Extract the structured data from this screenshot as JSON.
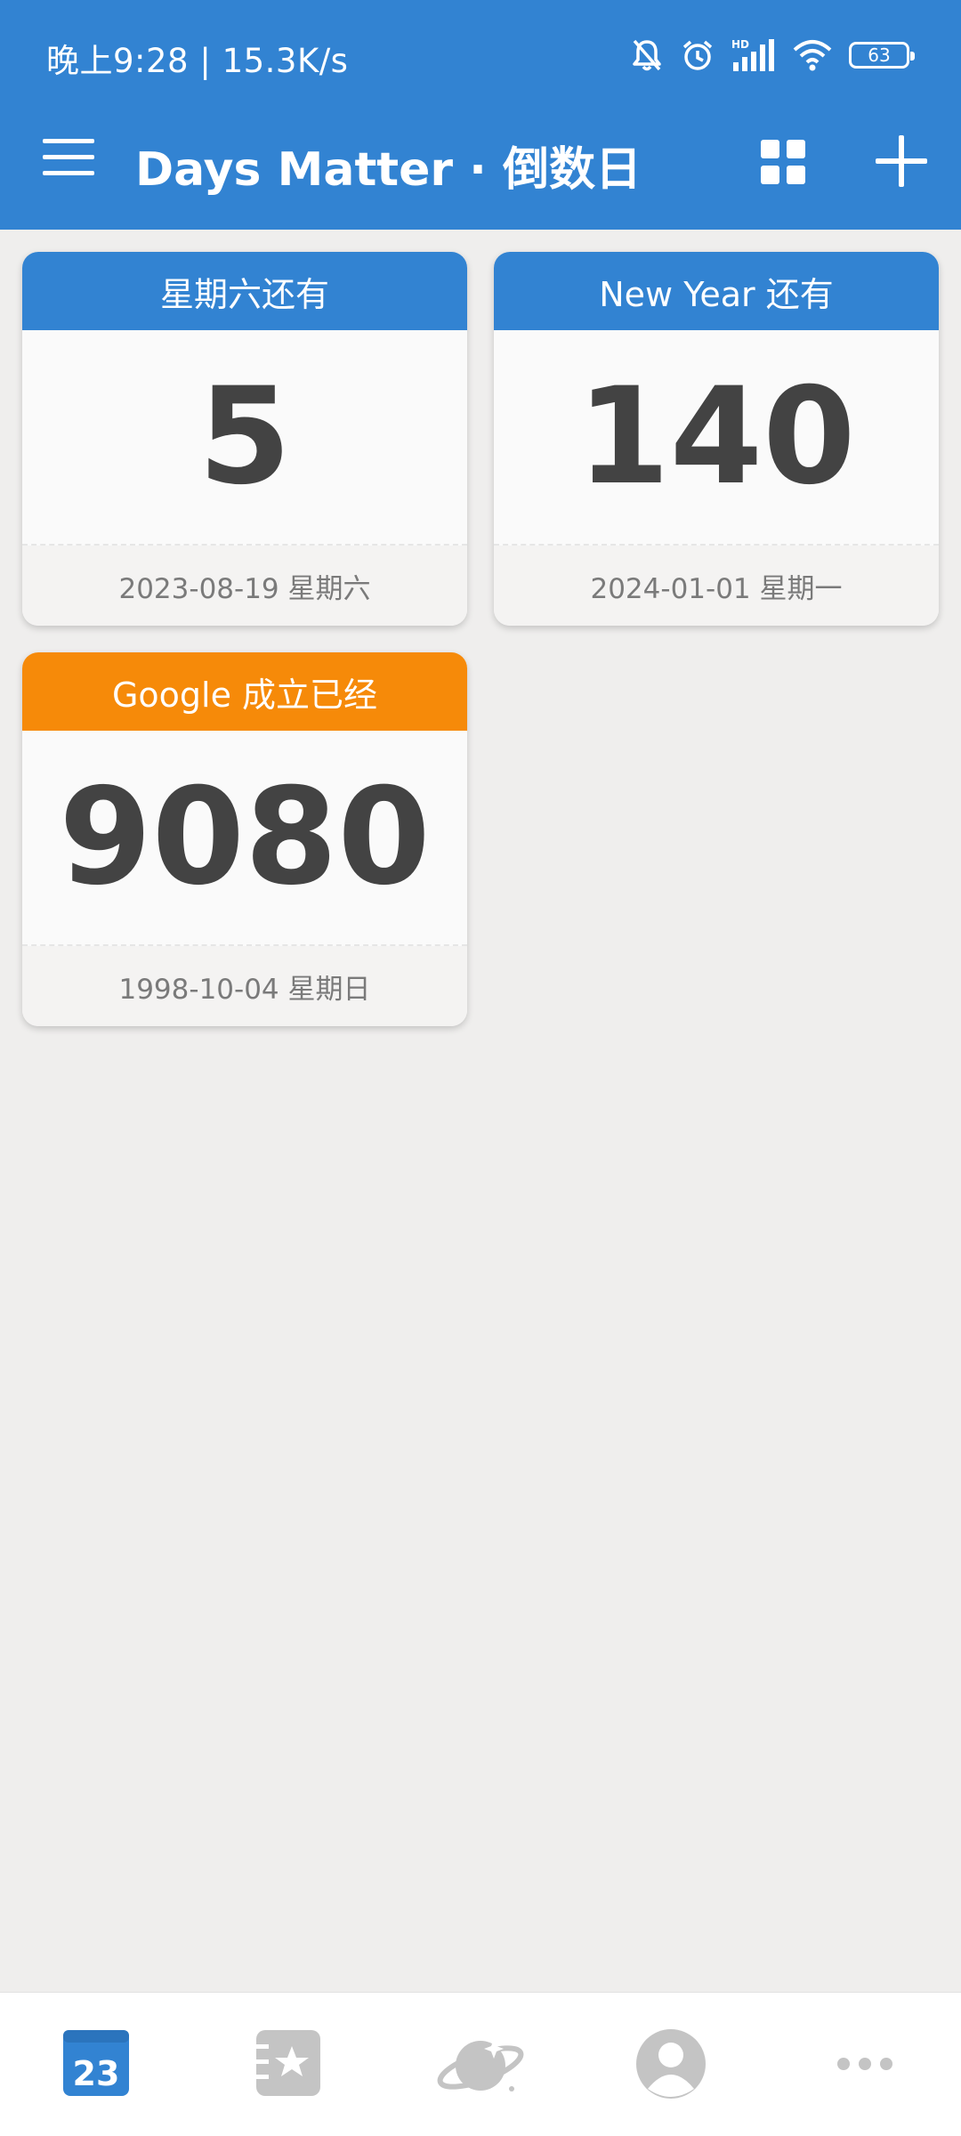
{
  "status_bar": {
    "time": "晚上9:28 | 15.3K/s",
    "battery": "63"
  },
  "app_bar": {
    "title": "Days Matter · 倒数日",
    "menu_icon": "menu-icon",
    "layout_icon": "grid-view-icon",
    "add_icon": "plus-icon"
  },
  "colors": {
    "primary": "#3283d2",
    "accent_orange": "#f68a09",
    "background": "#efeeed",
    "number_text": "#434343"
  },
  "cards": [
    {
      "title": "星期六还有",
      "days": "5",
      "date": "2023-08-19 星期六",
      "color": "#3283d2"
    },
    {
      "title": "New Year 还有",
      "days": "140",
      "date": "2024-01-01 星期一",
      "color": "#3283d2"
    },
    {
      "title": "Google 成立已经",
      "days": "9080",
      "date": "1998-10-04 星期日",
      "color": "#f68a09"
    }
  ],
  "bottom_nav": {
    "calendar_day": "23",
    "items": [
      "calendar-icon",
      "starred-list-icon",
      "planet-icon",
      "profile-icon",
      "more-icon"
    ]
  }
}
